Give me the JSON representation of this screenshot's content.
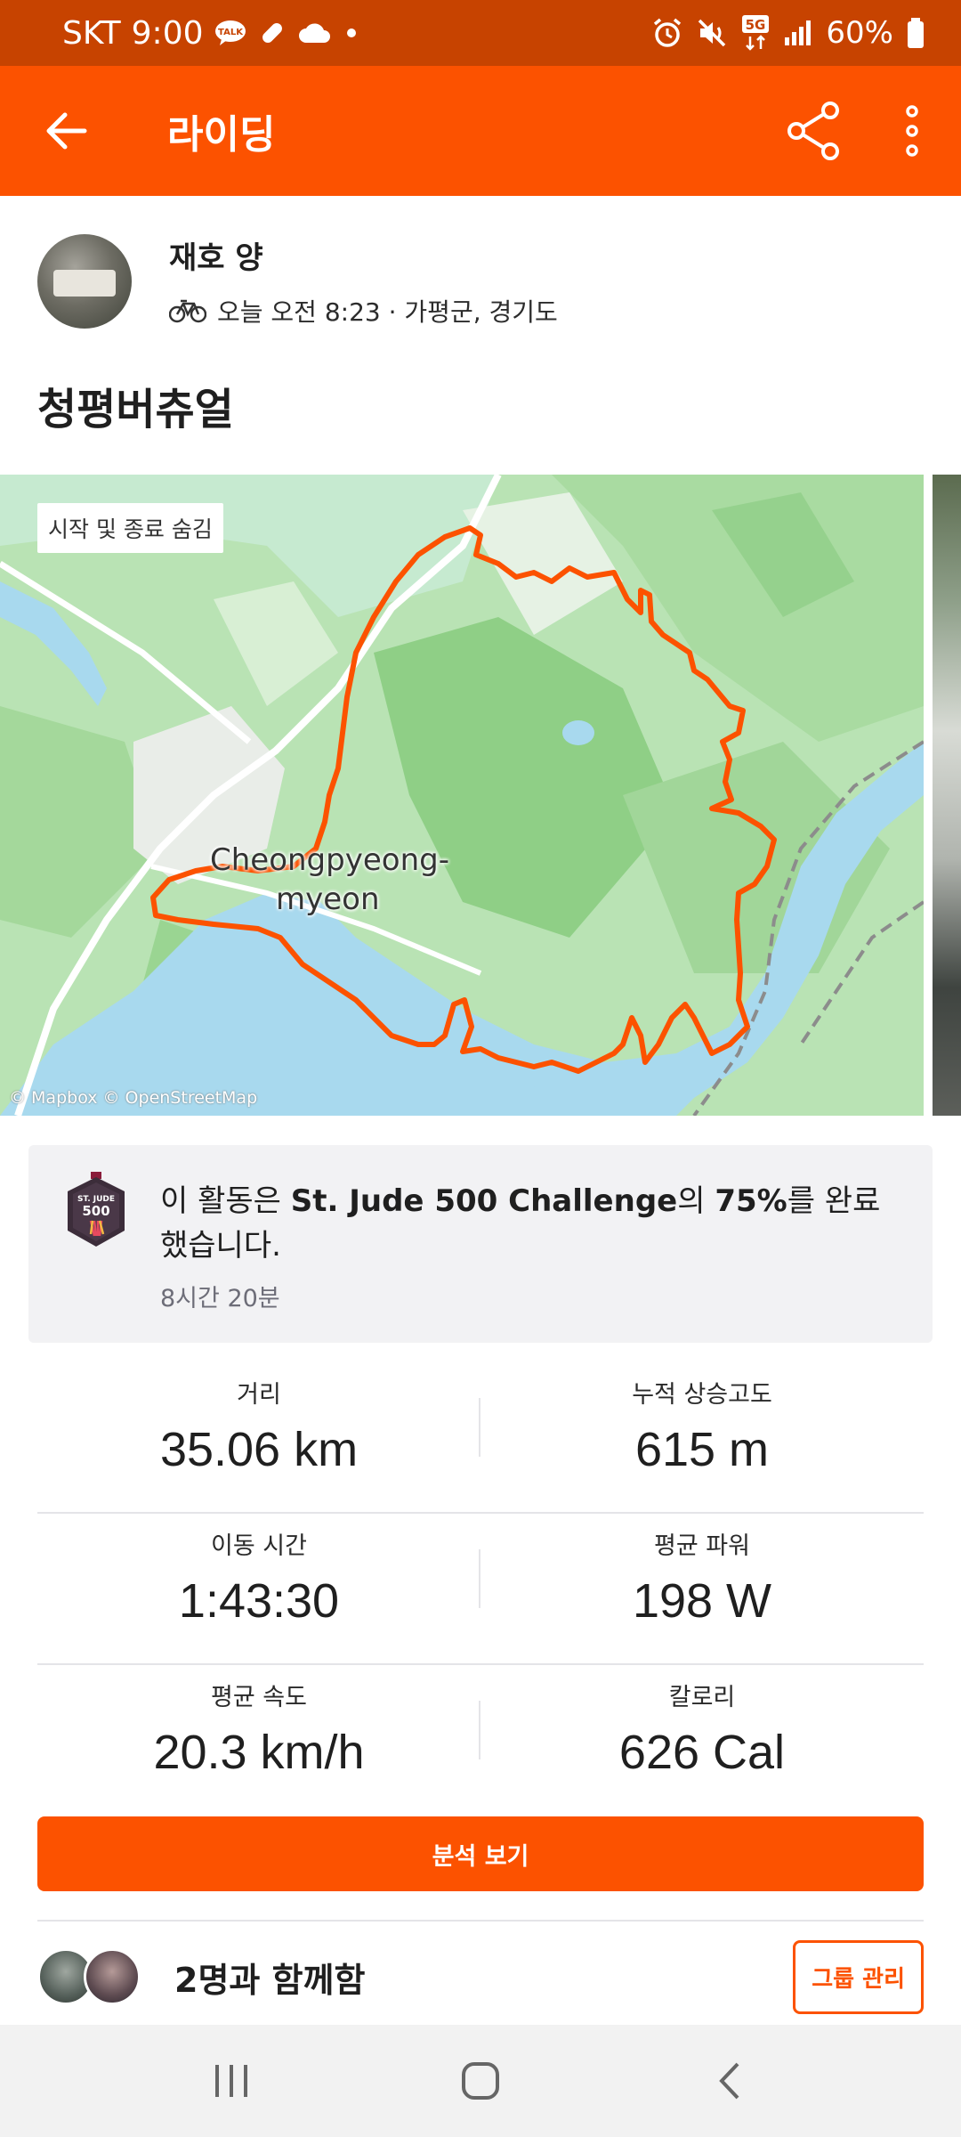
{
  "status_bar": {
    "carrier": "SKT",
    "time": "9:00",
    "talk_badge": "TALK",
    "network": "5G",
    "battery": "60%"
  },
  "app_bar": {
    "title": "라이딩",
    "icons": [
      "back-arrow-icon",
      "share-icon",
      "more-vertical-icon"
    ]
  },
  "athlete": {
    "name": "재호 양",
    "meta": "오늘 오전 8:23 · 가평군, 경기도"
  },
  "activity": {
    "title": "청평버츄얼"
  },
  "map": {
    "hide_start_label": "시작 및 종료 숨김",
    "place_label_line1": "Cheongpyeong-",
    "place_label_line2": "myeon",
    "attribution": "© Mapbox © OpenStreetMap",
    "route_color": "#fc5200"
  },
  "challenge": {
    "text_pre": "이 활동은 ",
    "challenge_name": "St. Jude 500 Challenge",
    "text_mid": "의 ",
    "percent": "75%",
    "text_post": "를 완료했습니다.",
    "duration": "8시간 20분",
    "badge_title": "ST. JUDE",
    "badge_number": "500"
  },
  "stats": [
    [
      {
        "label": "거리",
        "value": "35.06 km"
      },
      {
        "label": "누적 상승고도",
        "value": "615 m"
      }
    ],
    [
      {
        "label": "이동 시간",
        "value": "1:43:30"
      },
      {
        "label": "평균 파워",
        "value": "198 W"
      }
    ],
    [
      {
        "label": "평균 속도",
        "value": "20.3 km/h"
      },
      {
        "label": "칼로리",
        "value": "626 Cal"
      }
    ]
  ],
  "analysis_button": "분석 보기",
  "group": {
    "text": "2명과 함께함",
    "manage_button": "그룹 관리"
  },
  "colors": {
    "accent": "#fc5200",
    "status_bar": "#c74300"
  }
}
